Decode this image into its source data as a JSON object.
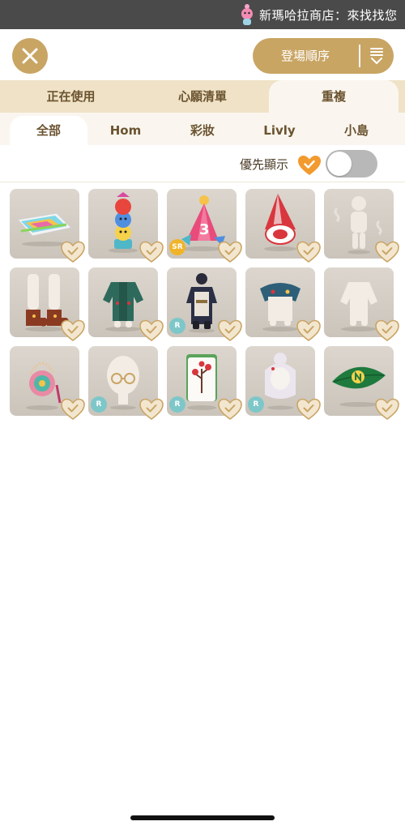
{
  "banner": {
    "text": "新瑪哈拉商店：來找找您",
    "mascot_icon": "mascot-icon"
  },
  "header": {
    "close_icon": "close-icon",
    "sort_label": "登場順序",
    "sort_icon": "sort-descending-icon"
  },
  "main_tabs": [
    {
      "label": "正在使用",
      "active": false
    },
    {
      "label": "心願清單",
      "active": false
    },
    {
      "label": "重複",
      "active": true
    }
  ],
  "sub_tabs": [
    {
      "label": "全部",
      "active": true
    },
    {
      "label": "Hom",
      "active": false
    },
    {
      "label": "彩妝",
      "active": false
    },
    {
      "label": "Livly",
      "active": false
    },
    {
      "label": "小島",
      "active": false
    }
  ],
  "priority": {
    "label": "優先顯示",
    "toggle_on": false
  },
  "items": [
    {
      "name": "rainbow-card-item",
      "rarity": ""
    },
    {
      "name": "bird-totem-item",
      "rarity": ""
    },
    {
      "name": "party-hat-item",
      "rarity": "SR"
    },
    {
      "name": "checkered-hat-item",
      "rarity": ""
    },
    {
      "name": "smoke-outfit-item",
      "rarity": ""
    },
    {
      "name": "brown-boots-item",
      "rarity": ""
    },
    {
      "name": "green-jacket-item",
      "rarity": ""
    },
    {
      "name": "dark-outfit-item",
      "rarity": "R"
    },
    {
      "name": "cape-item",
      "rarity": ""
    },
    {
      "name": "white-gloves-item",
      "rarity": ""
    },
    {
      "name": "pink-bag-item",
      "rarity": ""
    },
    {
      "name": "glasses-item",
      "rarity": "R"
    },
    {
      "name": "mahjong-tile-item",
      "rarity": "R"
    },
    {
      "name": "white-hair-item",
      "rarity": "R"
    },
    {
      "name": "leaf-item",
      "rarity": ""
    }
  ],
  "colors": {
    "accent_gold": "#c9a564",
    "heart_orange": "#f29a2e",
    "tab_bg": "#efe2c6"
  }
}
